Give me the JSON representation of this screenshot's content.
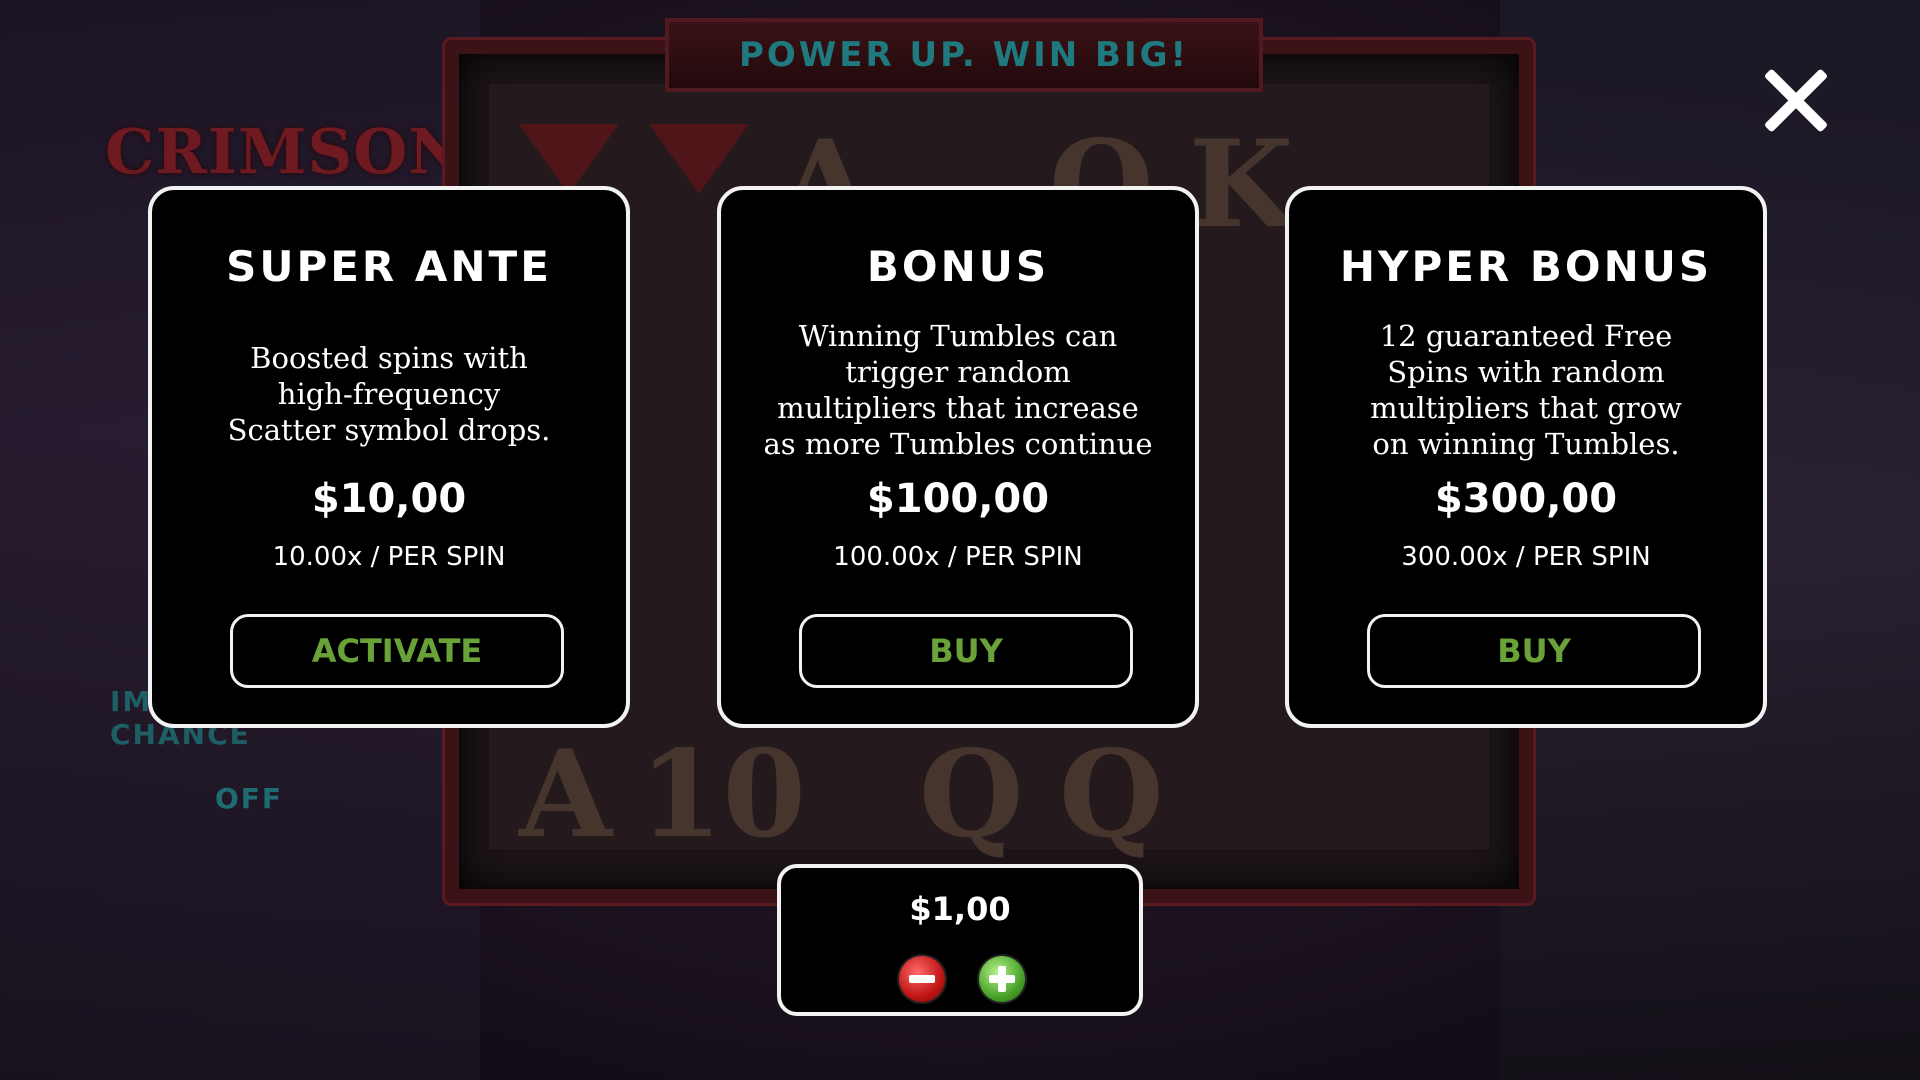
{
  "header": {
    "banner": "POWER UP. WIN BIG!"
  },
  "game": {
    "logo": "CRIMSON",
    "side_panel": {
      "label": "IM TRIGGER CHANCE",
      "value": "OFF"
    },
    "reel_symbols": [
      "A",
      "Q",
      "K",
      "A",
      "10",
      "Q",
      "Q"
    ]
  },
  "cards": [
    {
      "title": "SUPER ANTE",
      "desc_lines": [
        "Boosted spins with",
        "high-frequency",
        "Scatter symbol drops."
      ],
      "price": "$10,00",
      "rate": "10.00x / PER SPIN",
      "action": "ACTIVATE"
    },
    {
      "title": "BONUS",
      "desc_lines": [
        "Winning Tumbles can",
        "trigger random",
        "multipliers that increase",
        "as more Tumbles continue"
      ],
      "price": "$100,00",
      "rate": "100.00x / PER SPIN",
      "action": "BUY"
    },
    {
      "title": "HYPER BONUS",
      "desc_lines": [
        "12 guaranteed Free",
        "Spins with random",
        "multipliers that grow",
        "on winning Tumbles."
      ],
      "price": "$300,00",
      "rate": "300.00x / PER SPIN",
      "action": "BUY"
    }
  ],
  "bet": {
    "amount": "$1,00"
  },
  "icons": {
    "close": "close-icon",
    "minus": "minus-icon",
    "plus": "plus-icon"
  },
  "colors": {
    "action_text": "#6aa23a",
    "banner_text": "#1f7a7f",
    "card_border": "#f2f2f2"
  }
}
